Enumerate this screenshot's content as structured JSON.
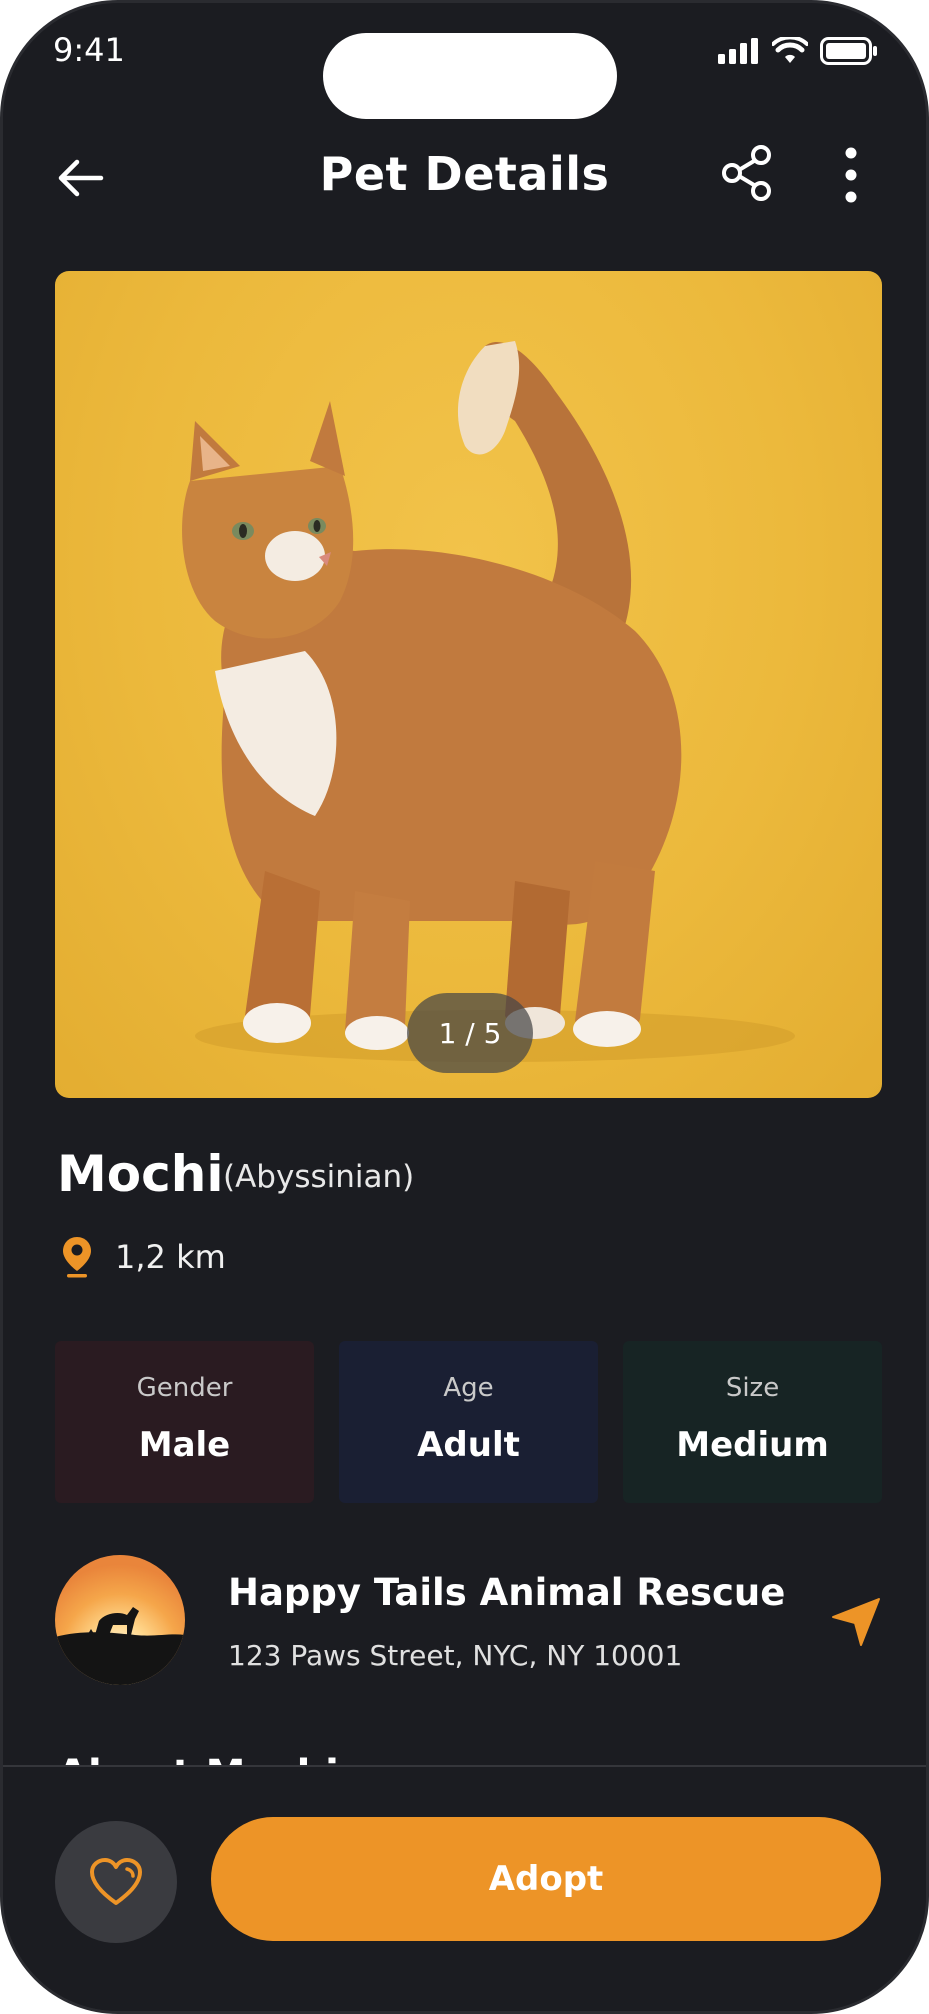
{
  "status_bar": {
    "time": "9:41"
  },
  "header": {
    "title": "Pet Details"
  },
  "gallery": {
    "counter": "1 / 5"
  },
  "pet": {
    "name": "Mochi",
    "breed": "(Abyssinian)",
    "distance": "1,2 km"
  },
  "stats": [
    {
      "label": "Gender",
      "value": "Male",
      "bg": "#2a1b21"
    },
    {
      "label": "Age",
      "value": "Adult",
      "bg": "#1a1f33"
    },
    {
      "label": "Size",
      "value": "Medium",
      "bg": "#172424"
    }
  ],
  "shelter": {
    "name": "Happy Tails Animal Rescue",
    "address": "123 Paws Street, NYC, NY 10001"
  },
  "about": {
    "heading": "About Mochi"
  },
  "actions": {
    "adopt_label": "Adopt"
  },
  "colors": {
    "accent": "#ed9427",
    "background": "#1b1c21"
  },
  "icons": [
    "back-arrow-icon",
    "share-icon",
    "more-vertical-icon",
    "location-pin-icon",
    "navigation-arrow-icon",
    "heart-icon"
  ]
}
